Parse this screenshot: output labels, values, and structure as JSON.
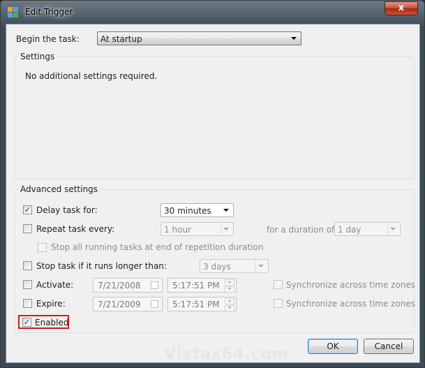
{
  "window": {
    "title": "Edit Trigger",
    "close_glyph": "x"
  },
  "begin": {
    "label": "Begin the task:",
    "value": "At startup"
  },
  "settings": {
    "legend": "Settings",
    "message": "No additional settings required."
  },
  "advanced": {
    "legend": "Advanced settings",
    "delay": {
      "label": "Delay task for:",
      "checked": true,
      "value": "30 minutes"
    },
    "repeat": {
      "label": "Repeat task every:",
      "checked": false,
      "value": "1 hour",
      "duration_label": "for a duration of:",
      "duration_value": "1 day"
    },
    "stop_all": {
      "label": "Stop all running tasks at end of repetition duration",
      "checked": false
    },
    "stop_longer": {
      "label": "Stop task if it runs longer than:",
      "checked": false,
      "value": "3 days"
    },
    "activate": {
      "label": "Activate:",
      "checked": false,
      "date": "7/21/2008",
      "time": "5:17:51 PM",
      "sync_label": "Synchronize across time zones"
    },
    "expire": {
      "label": "Expire:",
      "checked": false,
      "date": "7/21/2009",
      "time": "5:17:51 PM",
      "sync_label": "Synchronize across time zones"
    },
    "enabled": {
      "label": "Enabled",
      "checked": true
    }
  },
  "buttons": {
    "ok": "OK",
    "cancel": "Cancel"
  },
  "watermark": "Vistax64.com",
  "colors": {
    "highlight": "#cc1f1f",
    "check": "#1c3b80"
  }
}
